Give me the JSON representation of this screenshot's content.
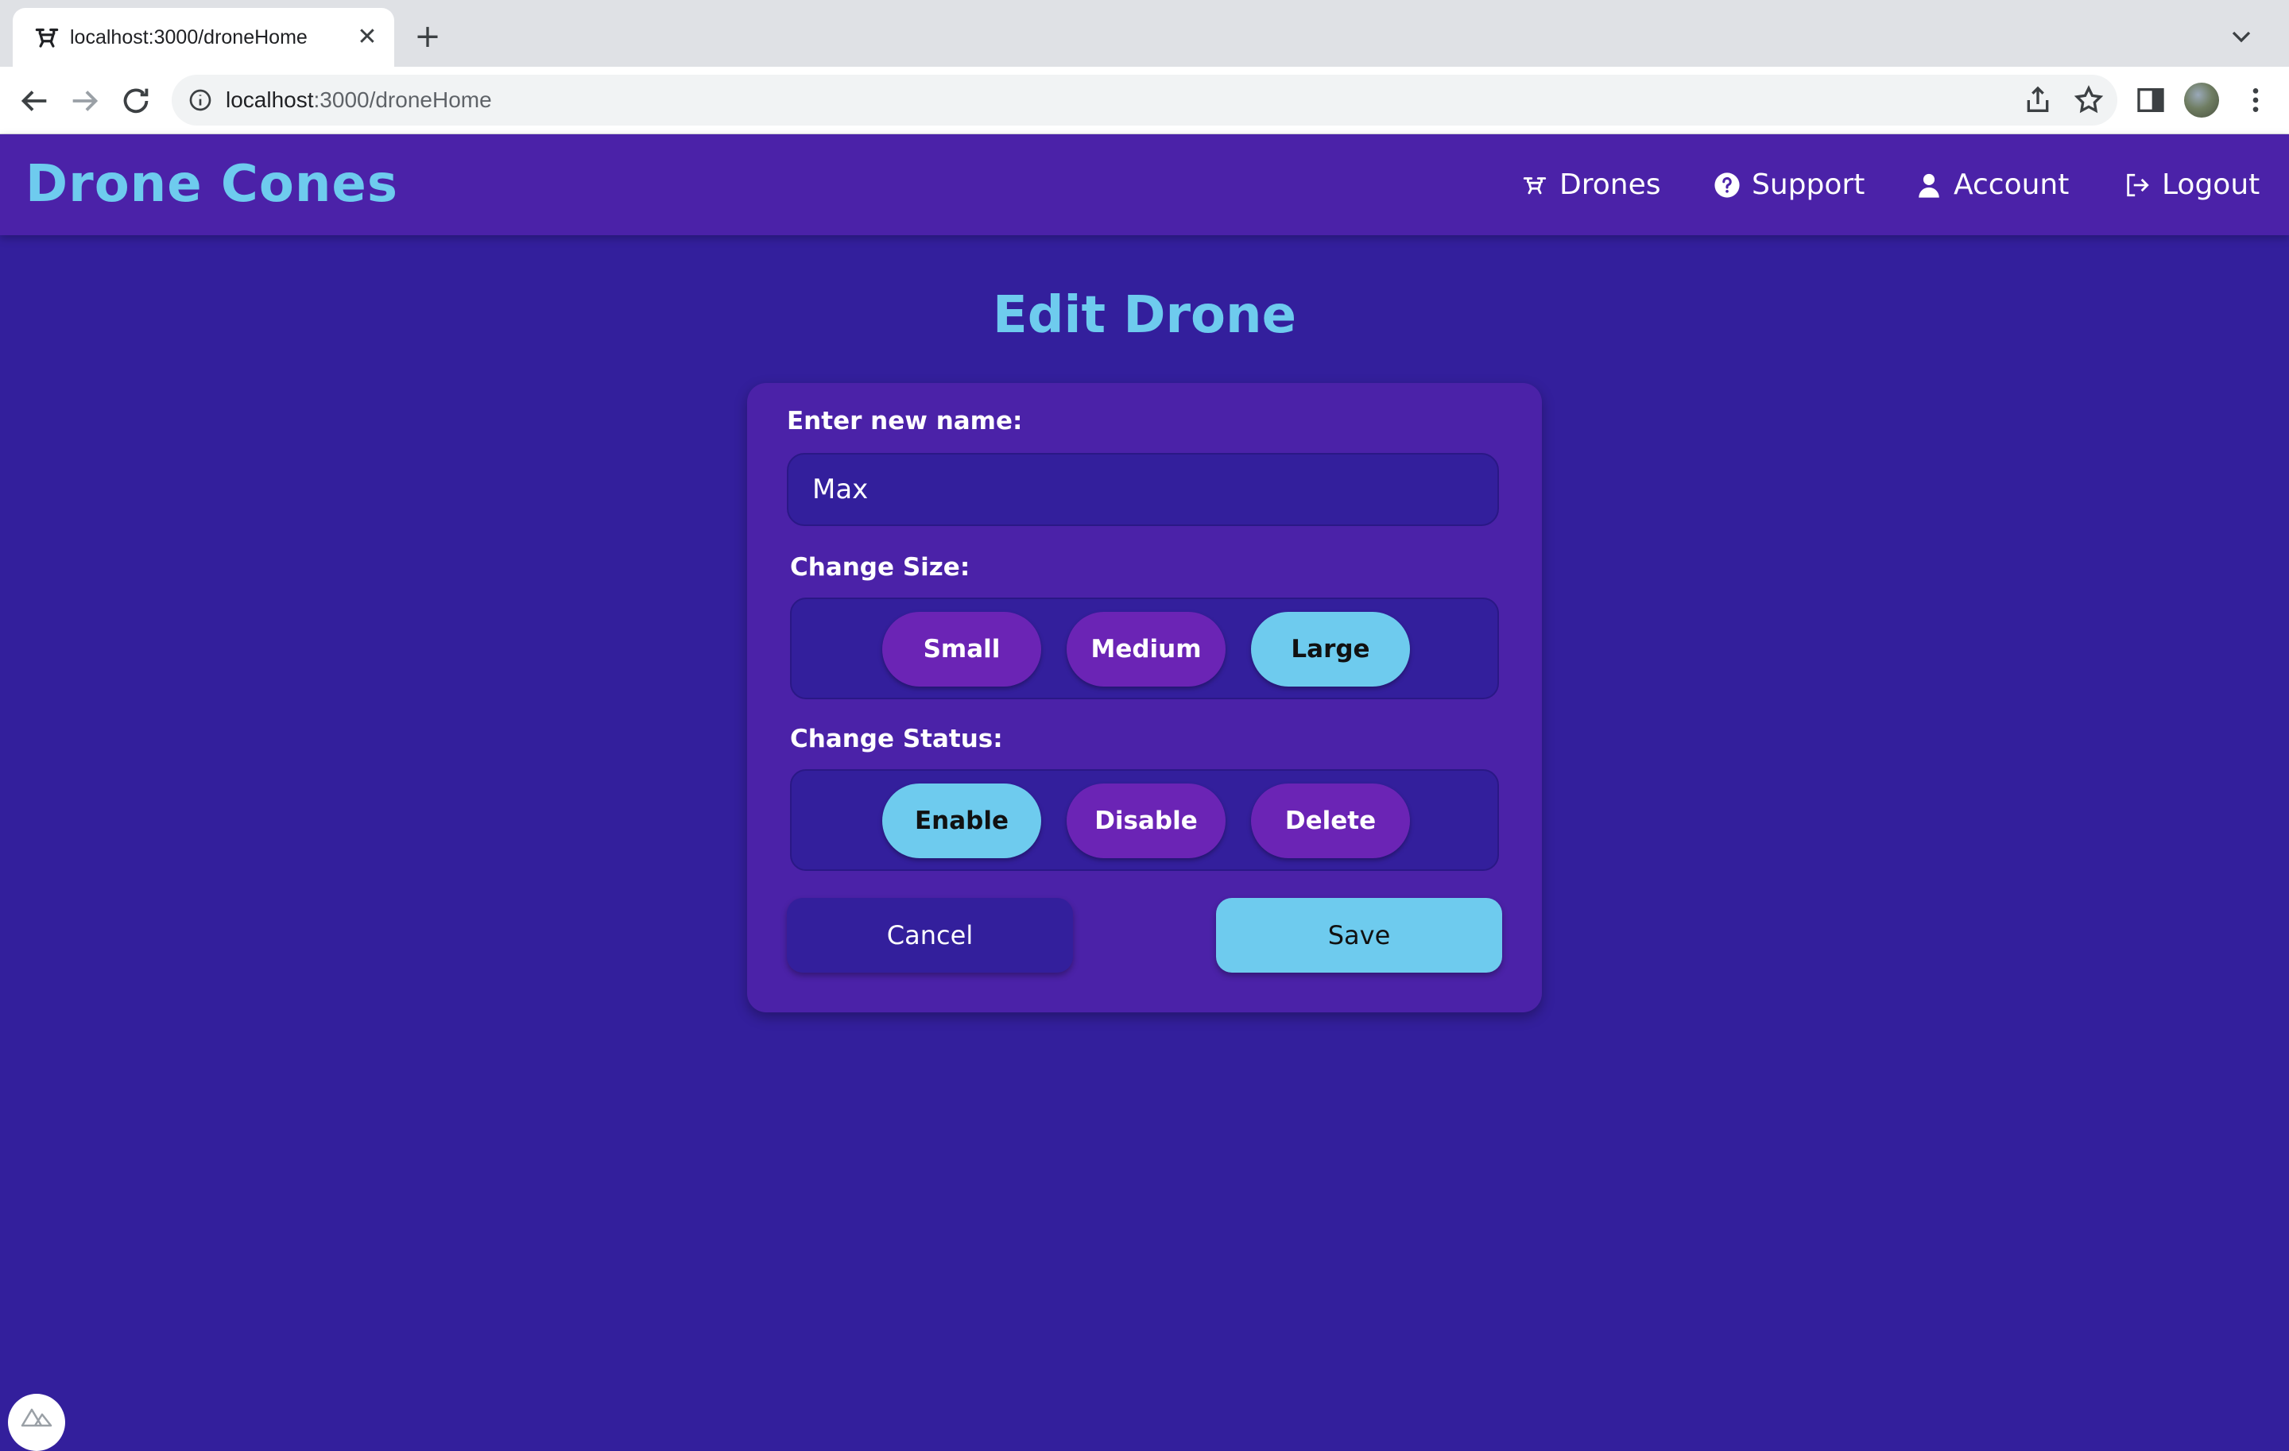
{
  "browser": {
    "tab_title": "localhost:3000/droneHome",
    "url_host": "localhost",
    "url_path": ":3000/droneHome",
    "icons": [
      "back-icon",
      "forward-icon",
      "reload-icon",
      "info-icon",
      "share-icon",
      "star-icon",
      "side-panel-icon",
      "menu-icon"
    ]
  },
  "app": {
    "logo": "Drone Cones",
    "nav": {
      "drones": "Drones",
      "support": "Support",
      "account": "Account",
      "logout": "Logout"
    }
  },
  "page": {
    "title": "Edit Drone",
    "name_label": "Enter new name:",
    "name_value": "Max",
    "size_label": "Change Size:",
    "size_options": [
      "Small",
      "Medium",
      "Large"
    ],
    "size_selected": "Large",
    "status_label": "Change Status:",
    "status_options": [
      "Enable",
      "Disable",
      "Delete"
    ],
    "status_selected": "Enable",
    "cancel": "Cancel",
    "save": "Save"
  },
  "colors": {
    "background": "#331f9c",
    "header": "#4b22a8",
    "accent": "#6ecbee",
    "pill": "#6b24b5"
  }
}
